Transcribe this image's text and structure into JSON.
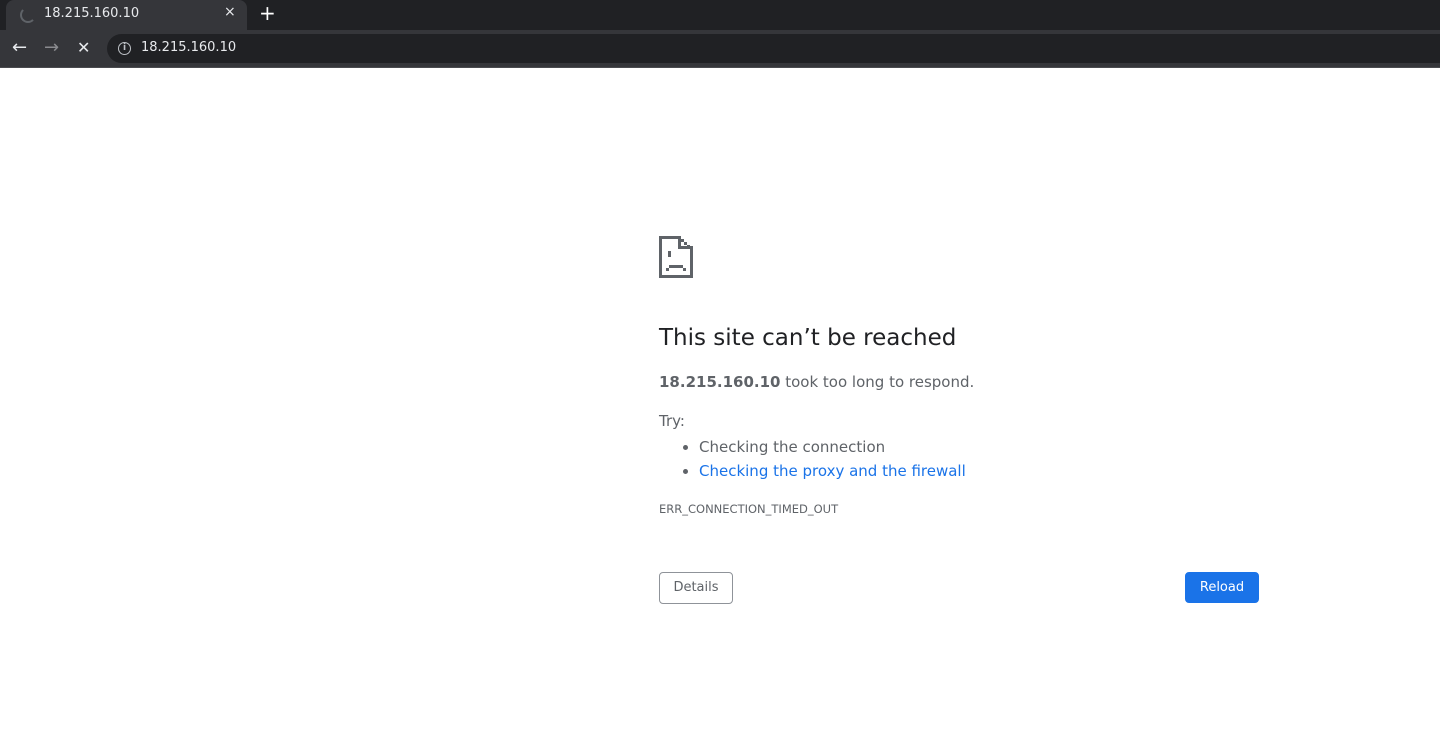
{
  "browser": {
    "tab": {
      "title": "18.215.160.10",
      "state": "loading"
    },
    "new_tab": "+",
    "tab_close": "×",
    "back": "←",
    "forward": "→",
    "stop": "✕",
    "address": "18.215.160.10",
    "info_icon": "i"
  },
  "error": {
    "title": "This site can’t be reached",
    "host": "18.215.160.10",
    "message": " took too long to respond.",
    "try_label": "Try:",
    "suggestions": [
      "Checking the connection",
      "Checking the proxy and the firewall"
    ],
    "code": "ERR_CONNECTION_TIMED_OUT",
    "details_button": "Details",
    "reload_button": "Reload"
  },
  "colors": {
    "accent": "#1a73e8",
    "chrome_dark": "#202124",
    "toolbar": "#35363a"
  }
}
